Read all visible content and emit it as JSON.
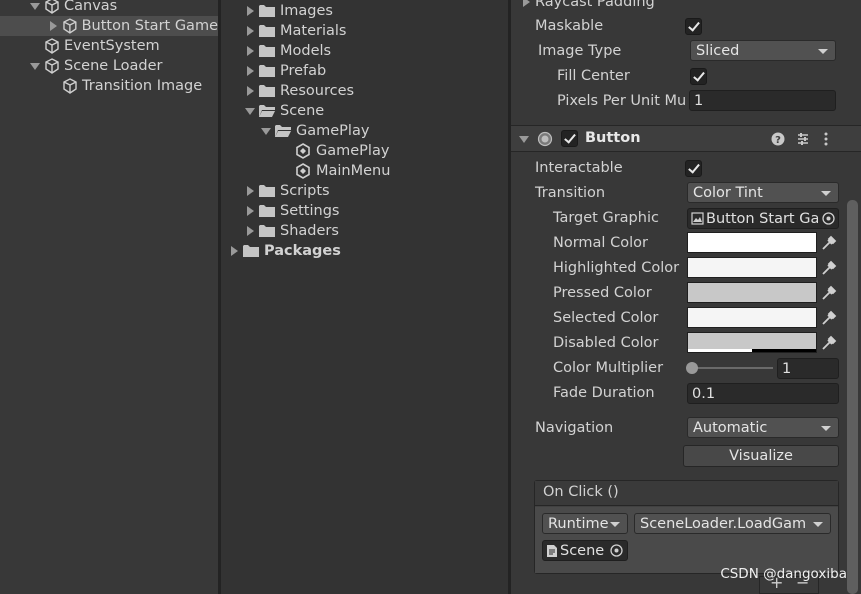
{
  "hierarchy": {
    "items": [
      {
        "label": "Canvas"
      },
      {
        "label": "Button Start Game"
      },
      {
        "label": "EventSystem"
      },
      {
        "label": "Scene Loader"
      },
      {
        "label": "Transition Image"
      }
    ]
  },
  "project": {
    "items": [
      {
        "label": "Images"
      },
      {
        "label": "Materials"
      },
      {
        "label": "Models"
      },
      {
        "label": "Prefab"
      },
      {
        "label": "Resources"
      },
      {
        "label": "Scene"
      },
      {
        "label": "GamePlay"
      },
      {
        "label": "GamePlay"
      },
      {
        "label": "MainMenu"
      },
      {
        "label": "Scripts"
      },
      {
        "label": "Settings"
      },
      {
        "label": "Shaders"
      },
      {
        "label": "Packages"
      }
    ]
  },
  "inspector": {
    "image": {
      "raycast_padding_label": "Raycast Padding",
      "maskable_label": "Maskable",
      "image_type_label": "Image Type",
      "image_type_value": "Sliced",
      "fill_center_label": "Fill Center",
      "ppu_label": "Pixels Per Unit Mu",
      "ppu_value": "1"
    },
    "button": {
      "title": "Button",
      "interactable_label": "Interactable",
      "transition_label": "Transition",
      "transition_value": "Color Tint",
      "target_graphic_label": "Target Graphic",
      "target_graphic_value": "Button Start Ga",
      "normal_color_label": "Normal Color",
      "highlighted_color_label": "Highlighted Color",
      "pressed_color_label": "Pressed Color",
      "selected_color_label": "Selected Color",
      "disabled_color_label": "Disabled Color",
      "color_multiplier_label": "Color Multiplier",
      "color_multiplier_value": "1",
      "fade_duration_label": "Fade Duration",
      "fade_duration_value": "0.1",
      "navigation_label": "Navigation",
      "navigation_value": "Automatic",
      "visualize_label": "Visualize",
      "onclick_label": "On Click ()",
      "runtime_value": "Runtime",
      "function_value": "SceneLoader.LoadGam",
      "object_value": "Scene",
      "colors": {
        "normal": "#ffffff",
        "highlighted": "#f5f5f5",
        "pressed": "#c8c8c8",
        "selected": "#f5f5f5",
        "disabled": "#c8c8c8"
      }
    }
  },
  "watermark": "CSDN @dangoxiba"
}
